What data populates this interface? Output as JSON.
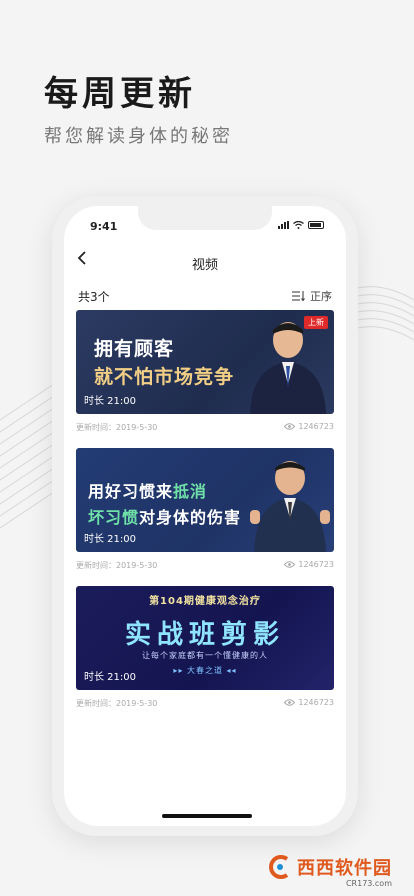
{
  "promo": {
    "title": "每周更新",
    "subtitle": "帮您解读身体的秘密"
  },
  "status_bar": {
    "time": "9:41"
  },
  "nav": {
    "back_icon": "chevron-left-icon",
    "title": "视频"
  },
  "list": {
    "count_label": "共3个",
    "sort_label": "正序",
    "sort_icon": "sort-icon"
  },
  "videos": [
    {
      "headline_line1": "拥有顾客",
      "headline_line2": "就不怕市场竞争",
      "badge": "上新",
      "duration": "时长 21:00",
      "date": "更新时间：2019-5-30",
      "views": "1246723"
    },
    {
      "headline_line1_pre": "用好习惯来",
      "headline_line1_hl": "抵消",
      "headline_line2_hl": "坏习惯",
      "headline_line2_post": "对身体的伤害",
      "duration": "时长 21:00",
      "date": "更新时间：2019-5-30",
      "views": "1246723"
    },
    {
      "headline_top": "第104期健康观念治疗",
      "headline_main": "实战班剪影",
      "headline_sub": "让每个家庭都有一个懂健康的人",
      "headline_brand": "▸▸ 大春之道 ◂◂",
      "duration": "时长 21:00",
      "date": "更新时间：2019-5-30",
      "views": "1246723"
    }
  ],
  "watermark": {
    "text": "西西软件园",
    "sub": "CR173.com"
  }
}
